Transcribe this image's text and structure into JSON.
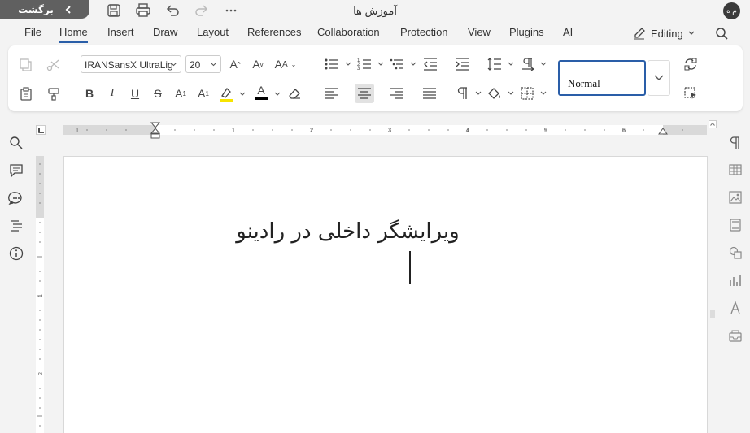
{
  "titlebar": {
    "back_label": "برگشت",
    "doc_title": "آموزش ها",
    "avatar_initials": "م ه",
    "icons": [
      "save-icon",
      "print-icon",
      "undo-icon",
      "redo-icon",
      "more-icon"
    ]
  },
  "menu": {
    "items": [
      "File",
      "Home",
      "Insert",
      "Draw",
      "Layout",
      "References",
      "Collaboration",
      "Protection",
      "View",
      "Plugins",
      "AI"
    ],
    "active": "Home",
    "mode_label": "Editing"
  },
  "ribbon": {
    "font_name": "IRANSansX UltraLig",
    "font_size": "20",
    "style_name": "Normal",
    "highlight_color": "#f7e400",
    "font_color": "#000000"
  },
  "document": {
    "heading": "ویرایشگر داخلی در رادینو",
    "ruler_numbers": [
      "1",
      "1",
      "2",
      "3",
      "4",
      "5",
      "6"
    ],
    "vruler_numbers": [
      "1",
      "2"
    ]
  },
  "colors": {
    "accent": "#2a5ea8",
    "back_button": "#606060"
  }
}
